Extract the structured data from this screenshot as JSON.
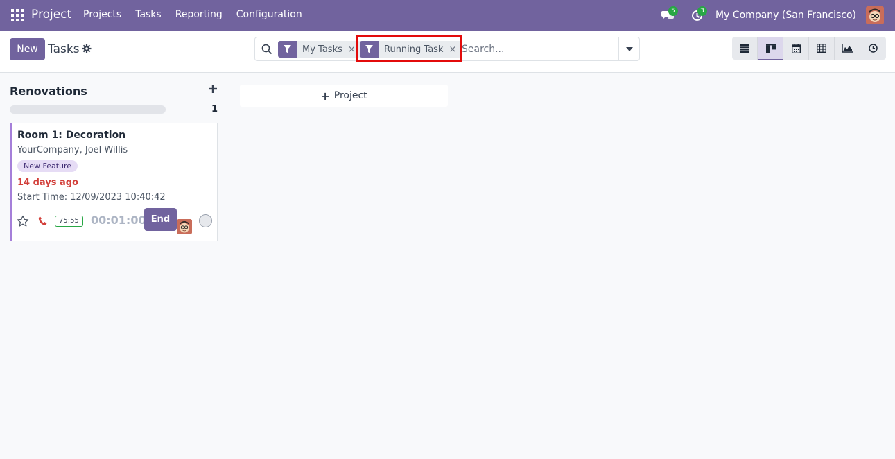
{
  "navbar": {
    "brand": "Project",
    "menu": [
      "Projects",
      "Tasks",
      "Reporting",
      "Configuration"
    ],
    "messages_badge": "5",
    "activities_badge": "3",
    "company": "My Company (San Francisco)"
  },
  "control": {
    "new_label": "New",
    "title": "Tasks",
    "facets": [
      "My Tasks",
      "Running Task"
    ],
    "facet_close": "×",
    "search_placeholder": "Search...",
    "views": [
      "list-icon",
      "kanban-icon",
      "calendar-icon",
      "pivot-icon",
      "graph-icon",
      "activity-icon"
    ],
    "active_view": "kanban-icon"
  },
  "kanban": {
    "column": {
      "title": "Renovations",
      "count": "1"
    },
    "card": {
      "title": "Room 1: Decoration",
      "subtitle": "YourCompany, Joel Willis",
      "tag": "New Feature",
      "deadline": "14 days ago",
      "start_time": "Start Time: 12/09/2023 10:40:42",
      "hours": "75:55",
      "timer": "00:01:00",
      "end_label": "End"
    },
    "add_project_label": "Project"
  },
  "colors": {
    "primary": "#71639e",
    "highlight": "#e30b0b",
    "deadline": "#d23f3a",
    "badge": "#28a745"
  }
}
